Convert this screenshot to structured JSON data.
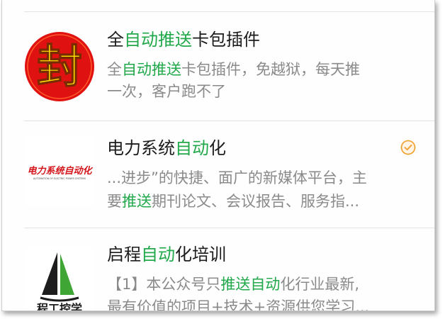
{
  "results": [
    {
      "title": [
        "全",
        "自动推送",
        "卡包插件"
      ],
      "desc_line1": [
        "全",
        "自动推送",
        "卡包插件，免越狱，每天推"
      ],
      "desc_line2": [
        "一次，客户跑不了"
      ],
      "thumb": {
        "glyph": "封",
        "icon": "seal-logo",
        "bg_color": "#e01111",
        "glyph_color": "#ffe400"
      }
    },
    {
      "title": [
        "电力系统",
        "自动",
        "化"
      ],
      "desc_line1": [
        "...进步”的快捷、面广的新媒体平台，主"
      ],
      "desc_line2": [
        "要",
        "推送",
        "期刊论文、会议报告、服务指..."
      ],
      "thumb": {
        "logo_text": "电力系统自动化",
        "logo_subtext": "AUTOMATION OF ELECTRIC POWER SYSTEMS",
        "icon": "journal-logo",
        "logo_color": "#d4141b"
      },
      "verified": {
        "icon": "verified-check-icon",
        "color": "#f3a33a"
      }
    },
    {
      "title": [
        "启程",
        "自动",
        "化培训"
      ],
      "desc_line1": [
        "【1】本公众号只",
        "推送自动",
        "化行业最新,"
      ],
      "desc_line2": [
        "最有价值的项目+技术+资源供您学习..."
      ],
      "thumb": {
        "logo_text": "程工控学",
        "icon": "sailboat-logo",
        "sail_color": "#3fa535"
      }
    }
  ],
  "colors": {
    "highlight": "#21a84a",
    "title": "#1c1c1c",
    "desc": "#8a8a8a"
  }
}
